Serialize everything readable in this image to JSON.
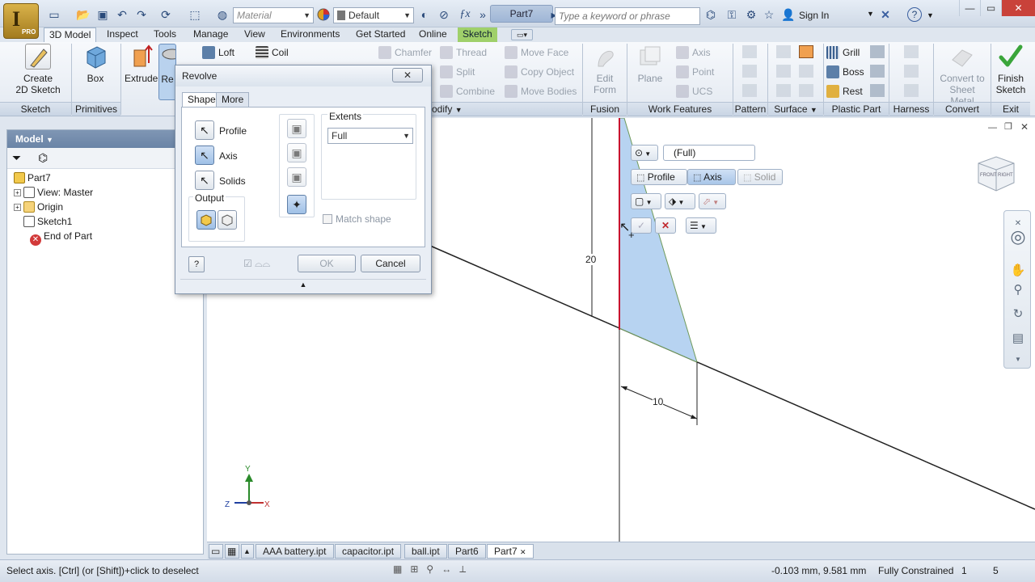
{
  "app": {
    "logo_letter": "I",
    "logo_badge": "PRO",
    "material_placeholder": "Material",
    "appearance_value": "Default",
    "document_title": "Part7",
    "search_placeholder": "Type a keyword or phrase",
    "sign_in": "Sign In"
  },
  "ribbon_tabs": [
    {
      "label": "3D Model"
    },
    {
      "label": "Inspect"
    },
    {
      "label": "Tools"
    },
    {
      "label": "Manage"
    },
    {
      "label": "View"
    },
    {
      "label": "Environments"
    },
    {
      "label": "Get Started"
    },
    {
      "label": "Online"
    },
    {
      "label": "Sketch"
    }
  ],
  "ribbon": {
    "create_sketch": "Create\n2D Sketch",
    "box": "Box",
    "extrude": "Extrude",
    "revolve_partial": "Re",
    "loft": "Loft",
    "coil": "Coil",
    "chamfer": "Chamfer",
    "thread": "Thread",
    "split": "Split",
    "combine": "Combine",
    "move_face": "Move Face",
    "copy_object": "Copy Object",
    "move_bodies": "Move Bodies",
    "edit_form_1": "Edit",
    "edit_form_2": "Form",
    "plane": "Plane",
    "axis": "Axis",
    "point": "Point",
    "ucs": "UCS",
    "grill": "Grill",
    "boss": "Boss",
    "rest": "Rest",
    "convert_1": "Convert to",
    "convert_2": "Sheet Metal",
    "finish_1": "Finish",
    "finish_2": "Sketch",
    "panels": {
      "sketch": "Sketch",
      "primitives": "Primitives",
      "modify": "odify",
      "fusion": "Fusion",
      "work_features": "Work Features",
      "pattern": "Pattern",
      "surface": "Surface",
      "plastic_part": "Plastic Part",
      "harness": "Harness",
      "convert": "Convert",
      "exit": "Exit"
    }
  },
  "browser": {
    "header": "Model",
    "tree": [
      {
        "label": "Part7"
      },
      {
        "label": "View: Master"
      },
      {
        "label": "Origin"
      },
      {
        "label": "Sketch1"
      },
      {
        "label": "End of Part"
      }
    ]
  },
  "dialog": {
    "title": "Revolve",
    "close": "✕",
    "tab_shape": "Shape",
    "tab_more": "More",
    "profile": "Profile",
    "axis": "Axis",
    "solids": "Solids",
    "output": "Output",
    "extents": "Extents",
    "extents_value": "Full",
    "match_shape": "Match shape",
    "ok": "OK",
    "cancel": "Cancel"
  },
  "mini_toolbar": {
    "extent": "(Full)",
    "profile": "Profile",
    "axis": "Axis",
    "solid": "Solid"
  },
  "sketch": {
    "dim_20": "20",
    "dim_10": "10"
  },
  "triad": {
    "x": "X",
    "y": "Y",
    "z": "Z"
  },
  "view_cube": {
    "front": "FRONT",
    "right": "RIGHT"
  },
  "doc_tabs": [
    {
      "label": "AAA battery.ipt"
    },
    {
      "label": "capacitor.ipt"
    },
    {
      "label": "ball.ipt"
    },
    {
      "label": "Part6"
    },
    {
      "label": "Part7"
    }
  ],
  "status": {
    "prompt": "Select axis. [Ctrl] (or [Shift])+click to deselect",
    "coords": "-0.103 mm, 9.581 mm",
    "constraint": "Fully Constrained",
    "num1": "1",
    "num2": "5"
  },
  "colors": {
    "profile_fill": "#b7d3f1",
    "axis_line": "#c8102e",
    "ribbon_bg": "#eef2f7",
    "context_tab": "#9fd06a",
    "finish_check": "#3aa53a"
  }
}
